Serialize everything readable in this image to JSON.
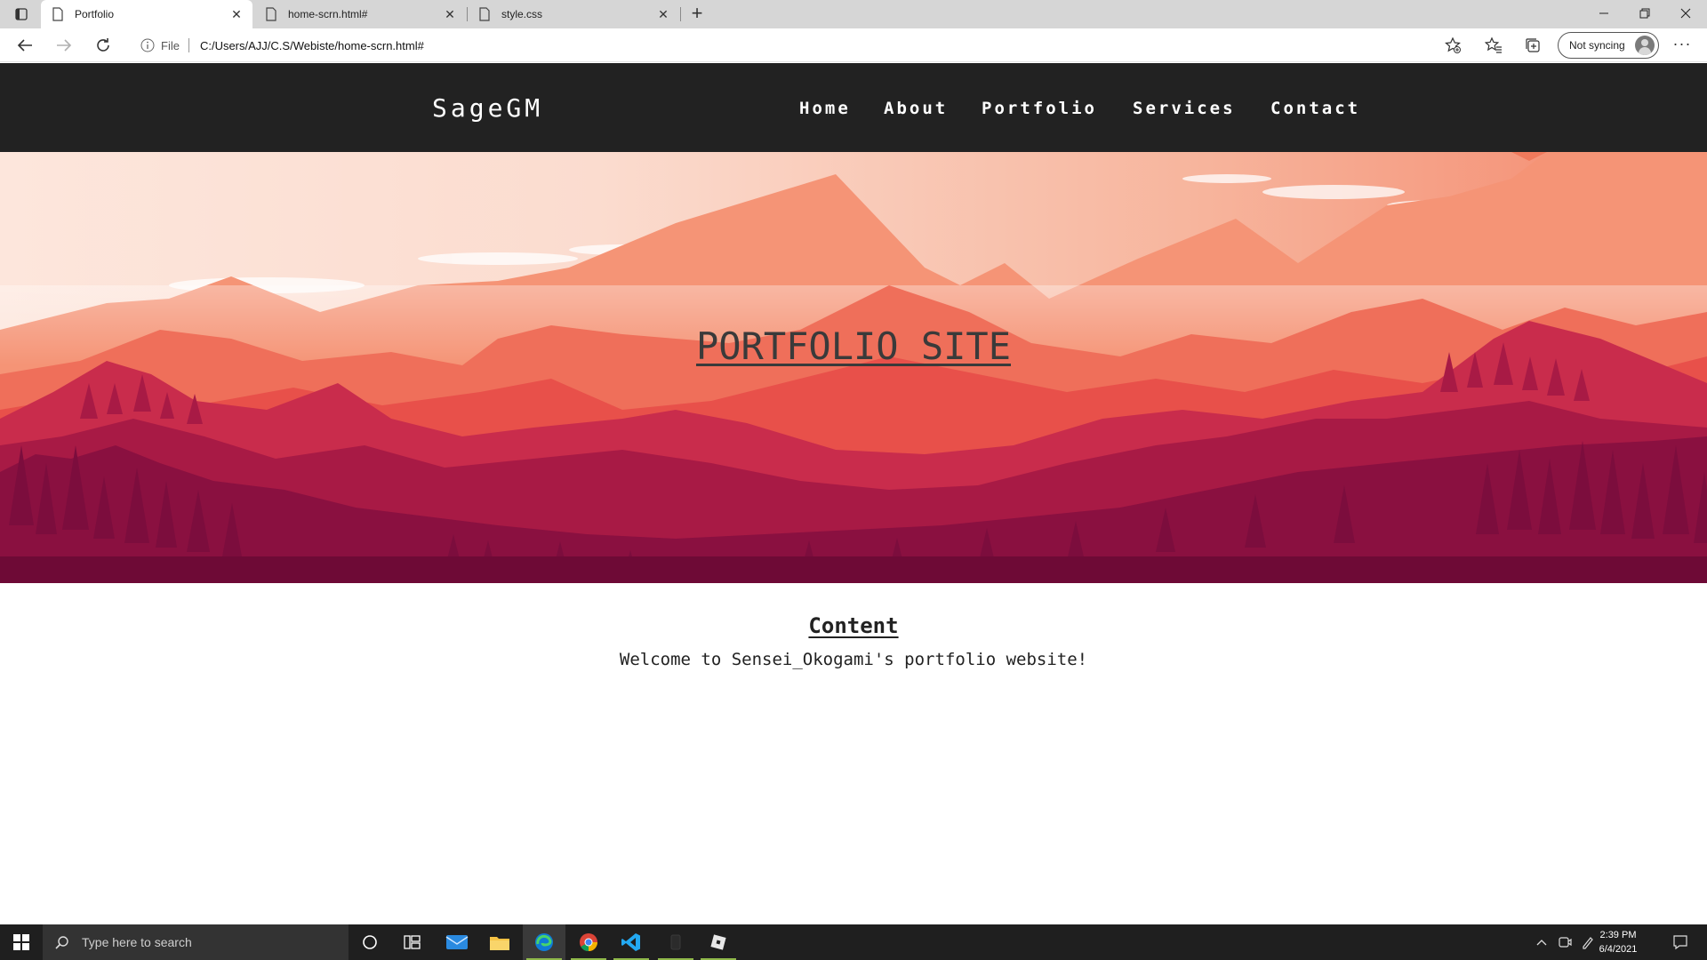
{
  "browser": {
    "tabs": [
      {
        "label": "Portfolio",
        "active": true
      },
      {
        "label": "home-scrn.html#",
        "active": false
      },
      {
        "label": "style.css",
        "active": false
      }
    ],
    "address": {
      "file_label": "File",
      "url": "C:/Users/AJJ/C.S/Webiste/home-scrn.html#"
    },
    "sync_label": "Not syncing",
    "more_label": "···"
  },
  "site": {
    "logo": "SageGM",
    "nav": [
      "Home",
      "About",
      "Portfolio",
      "Services",
      "Contact"
    ],
    "hero_title": "PORTFOLIO SITE",
    "content_title": "Content",
    "content_text": "Welcome to Sensei_Okogami's portfolio website!"
  },
  "taskbar": {
    "search_placeholder": "Type here to search",
    "time": "2:39 PM",
    "date": "6/4/2021",
    "apps": [
      "cortana-icon",
      "task-view-icon",
      "mail-icon",
      "file-explorer-icon",
      "edge-icon",
      "chrome-icon",
      "vscode-icon",
      "app-icon",
      "roblox-icon"
    ]
  },
  "colors": {
    "header_bg": "#222222",
    "sky_top": "#fbe3d8",
    "mountain_far": "#f48a6f",
    "mountain_mid": "#e8504a",
    "forest_mid": "#c42a4c",
    "forest_dark": "#7c0d3d"
  }
}
